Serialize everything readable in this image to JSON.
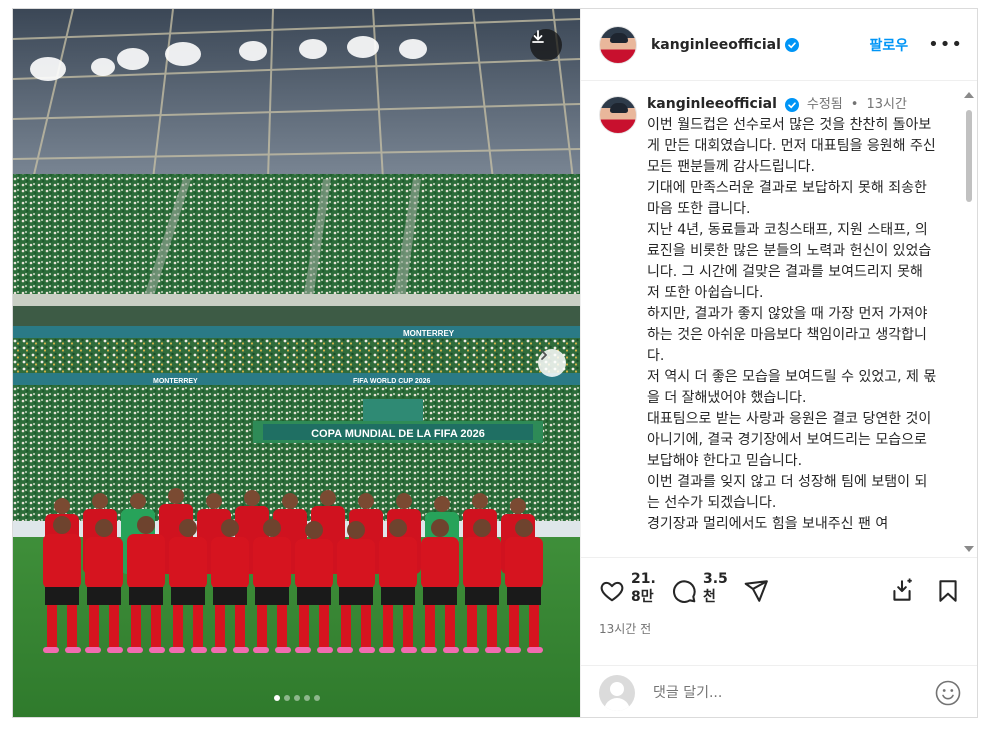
{
  "post": {
    "username": "kanginleeofficial",
    "follow_label": "팔로우",
    "more_label": "•••",
    "edited_label": "수정됨",
    "bullet": "•",
    "posted_ago": "13시간",
    "caption_paragraphs": [
      "이번 월드컵은 선수로서 많은 것을 찬찬히 돌아보게 만든 대회였습니다. 먼저 대표팀을 응원해 주신 모든 팬분들께 감사드립니다.",
      "기대에 만족스러운 결과로 보답하지 못해 죄송한 마음 또한 큽니다.",
      "지난 4년, 동료들과 코칭스태프, 지원 스태프, 의료진을 비롯한 많은 분들의 노력과 헌신이 있었습니다. 그 시간에 걸맞은 결과를 보여드리지 못해 저 또한 아쉽습니다.",
      "하지만, 결과가 좋지 않았을 때 가장 먼저 가져야 하는 것은 아쉬운 마음보다 책임이라고 생각합니다.",
      "저 역시 더 좋은 모습을 보여드릴 수 있었고, 제 몫을 더 잘해냈어야 했습니다.",
      "대표팀으로 받는 사랑과 응원은 결코 당연한 것이 아니기에, 결국 경기장에서 보여드리는 모습으로 보답해야 한다고 믿습니다.",
      "이번 결과를 잊지 않고 더 성장해 팀에 보탬이 되는 선수가 되겠습니다.",
      "경기장과 멀리에서도 힘을 보내주신 팬 여"
    ],
    "likes": "21.8만",
    "comments": "3.5천",
    "timestamp": "13시간 전",
    "comment_placeholder": "댓글 달기...",
    "media": {
      "banner_main": "COPA MUNDIAL DE LA FIFA 2026",
      "ribbon_1": "MONTERREY",
      "ribbon_2": "MONTERREY",
      "ribbon_3": "FIFA WORLD CUP 2026",
      "slide_count": 5,
      "active_slide": 1
    },
    "colors": {
      "accent": "#0095f6",
      "verified": "#0095f6",
      "text": "#262626",
      "muted": "#737373",
      "kit_red": "#d0121f"
    },
    "icons": [
      "download-icon",
      "next-arrow-icon",
      "heart-icon",
      "comment-icon",
      "share-icon",
      "bookmark-add-icon",
      "bookmark-icon",
      "emoji-icon",
      "verified-icon",
      "more-icon"
    ]
  }
}
